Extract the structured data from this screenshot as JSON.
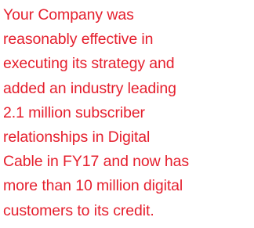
{
  "text": {
    "lines": [
      "Your Company was",
      "reasonably effective in",
      "executing its strategy and",
      "added an industry leading",
      "2.1 million subscriber",
      "relationships in Digital",
      "Cable in FY17 and now has",
      "more than 10 million digital",
      "customers to its credit."
    ]
  },
  "colors": {
    "text": "#e5202e",
    "background": "#ffffff"
  }
}
